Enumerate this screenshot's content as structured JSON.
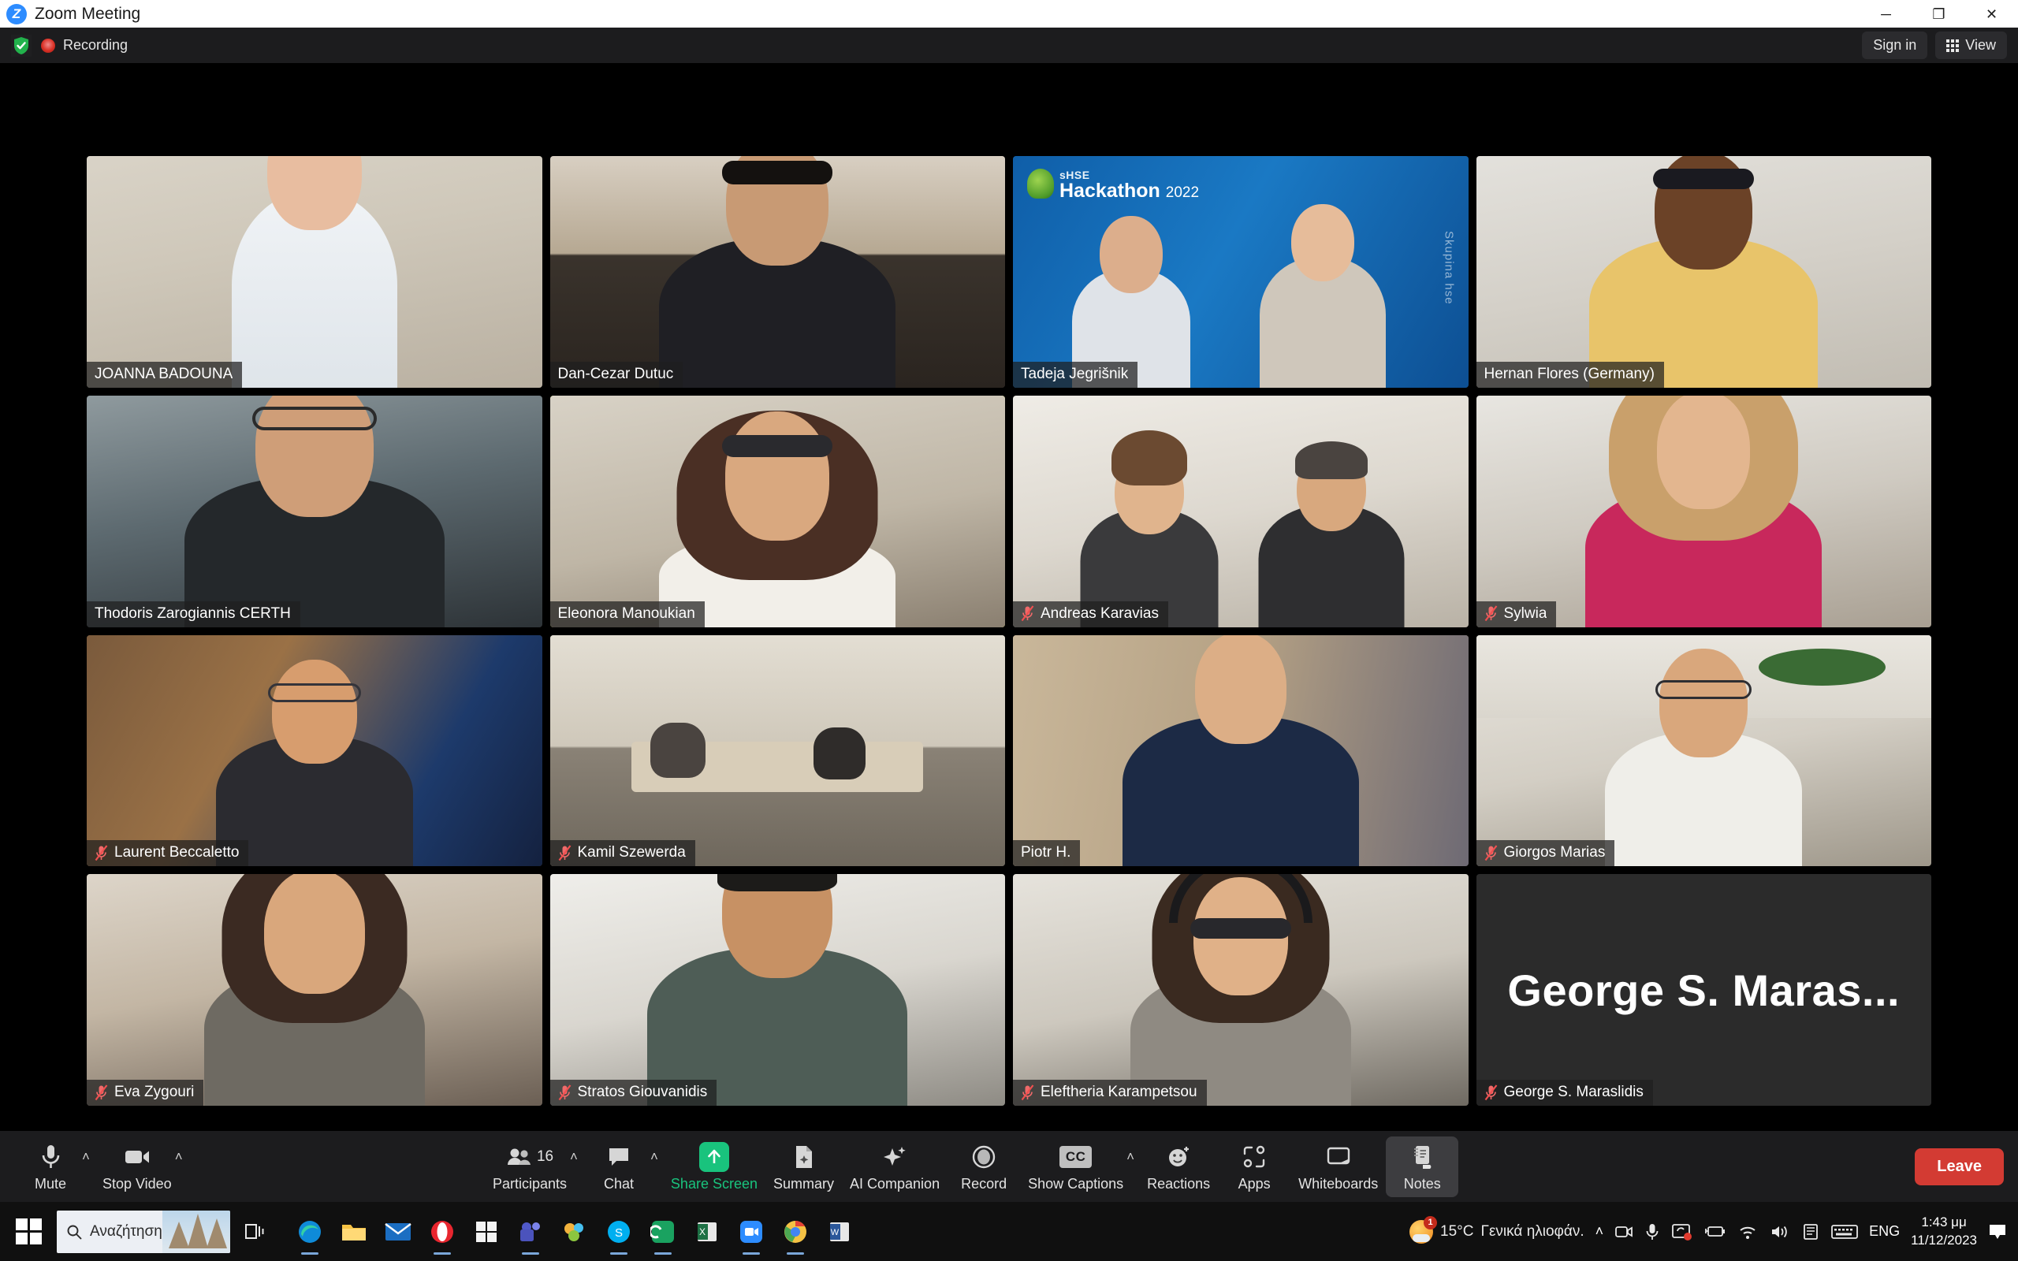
{
  "window": {
    "title": "Zoom Meeting",
    "logo_letter": "Z",
    "minimize": "─",
    "maximize": "❐",
    "close": "✕",
    "minimize_icon": "minimize-icon",
    "maximize_icon": "maximize-icon",
    "close_icon": "close-icon"
  },
  "header": {
    "shield_icon": "encryption-shield-icon",
    "recording_icon": "recording-dot-icon",
    "recording_label": "Recording",
    "sign_in_label": "Sign in",
    "view_label": "View",
    "view_icon": "grid-view-icon"
  },
  "banner": {
    "small_text": "sHSE",
    "large_text": "Hackathon",
    "year": "2022",
    "side_text": "Skupina hse"
  },
  "participants": [
    {
      "name": "JOANNA BADOUNA",
      "muted": false,
      "active_speaker": false,
      "video": true
    },
    {
      "name": "Dan-Cezar Dutuc",
      "muted": false,
      "active_speaker": false,
      "video": true
    },
    {
      "name": "Tadeja Jegrišnik",
      "muted": false,
      "active_speaker": false,
      "video": true
    },
    {
      "name": "Hernan Flores (Germany)",
      "muted": false,
      "active_speaker": false,
      "video": true
    },
    {
      "name": "Thodoris Zarogiannis CERTH",
      "muted": false,
      "active_speaker": false,
      "video": true
    },
    {
      "name": "Eleonora Manoukian",
      "muted": false,
      "active_speaker": true,
      "video": true
    },
    {
      "name": "Andreas Karavias",
      "muted": true,
      "active_speaker": false,
      "video": true
    },
    {
      "name": "Sylwia",
      "muted": true,
      "active_speaker": false,
      "video": true
    },
    {
      "name": "Laurent Beccaletto",
      "muted": true,
      "active_speaker": false,
      "video": true
    },
    {
      "name": "Kamil Szewerda",
      "muted": true,
      "active_speaker": false,
      "video": true
    },
    {
      "name": "Piotr H.",
      "muted": false,
      "active_speaker": false,
      "video": true
    },
    {
      "name": "Giorgos Marias",
      "muted": true,
      "active_speaker": false,
      "video": true
    },
    {
      "name": "Eva Zygouri",
      "muted": true,
      "active_speaker": false,
      "video": true
    },
    {
      "name": "Stratos Giouvanidis",
      "muted": true,
      "active_speaker": false,
      "video": true
    },
    {
      "name": "Eleftheria Karampetsou",
      "muted": true,
      "active_speaker": false,
      "video": true
    },
    {
      "name": "George S. Maraslidis",
      "muted": true,
      "active_speaker": false,
      "video": false,
      "avatar_text": "George S. Maras..."
    }
  ],
  "toolbar": {
    "mute_label": "Mute",
    "mute_icon": "microphone-icon",
    "stop_video_label": "Stop Video",
    "stop_video_icon": "camera-icon",
    "participants_label": "Participants",
    "participants_icon": "people-icon",
    "participants_count": "16",
    "chat_label": "Chat",
    "chat_icon": "chat-bubble-icon",
    "share_screen_label": "Share Screen",
    "share_screen_icon": "share-screen-up-arrow-icon",
    "summary_label": "Summary",
    "summary_icon": "summary-document-icon",
    "ai_companion_label": "AI Companion",
    "ai_companion_icon": "sparkle-icon",
    "record_label": "Record",
    "record_icon": "record-circle-icon",
    "show_captions_label": "Show Captions",
    "show_captions_icon": "closed-captions-icon",
    "reactions_label": "Reactions",
    "reactions_icon": "smiley-plus-icon",
    "apps_label": "Apps",
    "apps_icon": "apps-icon",
    "whiteboards_label": "Whiteboards",
    "whiteboards_icon": "whiteboard-icon",
    "notes_label": "Notes",
    "notes_icon": "notes-icon",
    "leave_label": "Leave",
    "caret": "˄",
    "share_accent_color": "#19c37d",
    "leave_color": "#d33b33"
  },
  "taskbar": {
    "start_icon": "windows-start-icon",
    "search_placeholder": "Αναζήτηση",
    "search_icon": "search-icon",
    "task_view_icon": "task-view-icon",
    "apps": [
      {
        "name": "edge-icon"
      },
      {
        "name": "file-explorer-icon"
      },
      {
        "name": "mail-icon"
      },
      {
        "name": "opera-icon"
      },
      {
        "name": "microsoft-store-icon"
      },
      {
        "name": "teams-icon"
      },
      {
        "name": "photos-icon"
      },
      {
        "name": "skype-icon"
      },
      {
        "name": "drive-icon"
      },
      {
        "name": "excel-icon"
      },
      {
        "name": "zoom-icon"
      },
      {
        "name": "chrome-icon"
      },
      {
        "name": "word-icon"
      }
    ],
    "weather_temp": "15°C",
    "weather_desc": "Γενικά ηλιοφάν.",
    "weather_badge": "1",
    "tray_caret": "˄",
    "tray_icons": [
      "camera-tray-icon",
      "microphone-tray-icon",
      "screen-share-tray-icon",
      "battery-icon",
      "wifi-icon",
      "volume-icon",
      "onedrive-icon",
      "keyboard-layout-icon"
    ],
    "language": "ENG",
    "clock_time": "1:43 μμ",
    "clock_date": "11/12/2023",
    "notification_icon": "notification-icon"
  }
}
